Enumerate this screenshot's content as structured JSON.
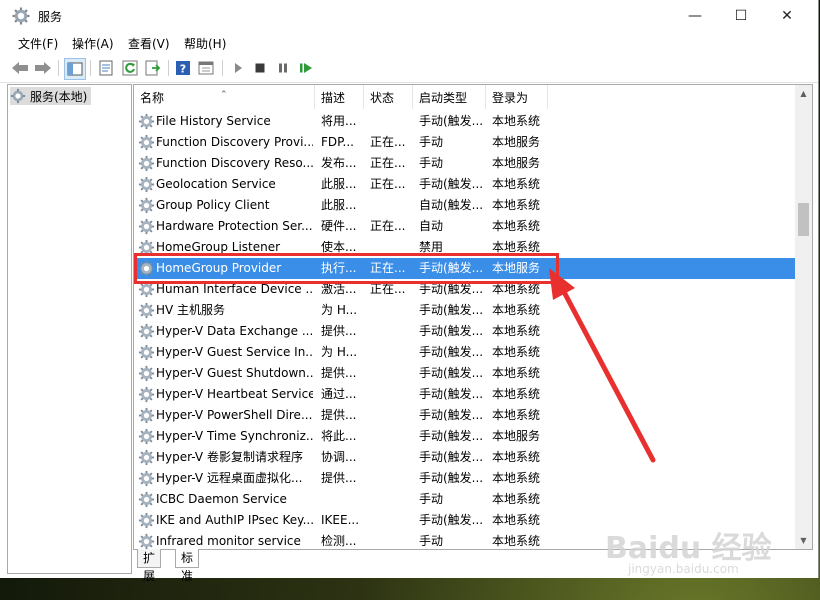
{
  "window": {
    "title": "服务",
    "controls": {
      "minimize": "—",
      "maximize": "☐",
      "close": "✕"
    }
  },
  "menu": [
    "文件(F)",
    "操作(A)",
    "查看(V)",
    "帮助(H)"
  ],
  "toolbar_icons": [
    "back-icon",
    "forward-icon",
    "console-tree-icon",
    "properties-icon",
    "refresh-icon",
    "export-icon",
    "help-icon",
    "view-icon",
    "start-icon",
    "stop-icon",
    "pause-icon",
    "restart-icon"
  ],
  "tree": {
    "label": "服务(本地)"
  },
  "columns": {
    "name": "名称",
    "desc": "描述",
    "status": "状态",
    "startup": "启动类型",
    "logon": "登录为"
  },
  "services": [
    {
      "name": "File History Service",
      "desc": "将用...",
      "status": "",
      "startup": "手动(触发...",
      "logon": "本地系统"
    },
    {
      "name": "Function Discovery Provi...",
      "desc": "FDP...",
      "status": "正在...",
      "startup": "手动",
      "logon": "本地服务"
    },
    {
      "name": "Function Discovery Reso...",
      "desc": "发布...",
      "status": "正在...",
      "startup": "手动",
      "logon": "本地服务"
    },
    {
      "name": "Geolocation Service",
      "desc": "此服...",
      "status": "正在...",
      "startup": "手动(触发...",
      "logon": "本地系统"
    },
    {
      "name": "Group Policy Client",
      "desc": "此服...",
      "status": "",
      "startup": "自动(触发...",
      "logon": "本地系统"
    },
    {
      "name": "Hardware Protection Ser...",
      "desc": "硬件...",
      "status": "正在...",
      "startup": "自动",
      "logon": "本地系统"
    },
    {
      "name": "HomeGroup Listener",
      "desc": "使本...",
      "status": "",
      "startup": "禁用",
      "logon": "本地系统"
    },
    {
      "name": "HomeGroup Provider",
      "desc": "执行...",
      "status": "正在...",
      "startup": "手动(触发...",
      "logon": "本地服务",
      "selected": true
    },
    {
      "name": "Human Interface Device ...",
      "desc": "激活...",
      "status": "正在...",
      "startup": "手动(触发...",
      "logon": "本地系统"
    },
    {
      "name": "HV 主机服务",
      "desc": "为 H...",
      "status": "",
      "startup": "手动(触发...",
      "logon": "本地系统"
    },
    {
      "name": "Hyper-V Data Exchange ...",
      "desc": "提供...",
      "status": "",
      "startup": "手动(触发...",
      "logon": "本地系统"
    },
    {
      "name": "Hyper-V Guest Service In...",
      "desc": "为 H...",
      "status": "",
      "startup": "手动(触发...",
      "logon": "本地系统"
    },
    {
      "name": "Hyper-V Guest Shutdown...",
      "desc": "提供...",
      "status": "",
      "startup": "手动(触发...",
      "logon": "本地系统"
    },
    {
      "name": "Hyper-V Heartbeat Service",
      "desc": "通过...",
      "status": "",
      "startup": "手动(触发...",
      "logon": "本地系统"
    },
    {
      "name": "Hyper-V PowerShell Dire...",
      "desc": "提供...",
      "status": "",
      "startup": "手动(触发...",
      "logon": "本地系统"
    },
    {
      "name": "Hyper-V Time Synchroniz...",
      "desc": "将此...",
      "status": "",
      "startup": "手动(触发...",
      "logon": "本地服务"
    },
    {
      "name": "Hyper-V 卷影复制请求程序",
      "desc": "协调...",
      "status": "",
      "startup": "手动(触发...",
      "logon": "本地系统"
    },
    {
      "name": "Hyper-V 远程桌面虚拟化...",
      "desc": "提供...",
      "status": "",
      "startup": "手动(触发...",
      "logon": "本地系统"
    },
    {
      "name": "ICBC Daemon Service",
      "desc": "",
      "status": "",
      "startup": "手动",
      "logon": "本地系统"
    },
    {
      "name": "IKE and AuthIP IPsec Key...",
      "desc": "IKEE...",
      "status": "",
      "startup": "手动(触发...",
      "logon": "本地系统"
    },
    {
      "name": "Infrared monitor service",
      "desc": "检测...",
      "status": "",
      "startup": "手动",
      "logon": "本地系统"
    }
  ],
  "tabs": [
    "扩展",
    "标准"
  ],
  "watermark": {
    "main": "Baidu 经验",
    "sub": "jingyan.baidu.com"
  },
  "colors": {
    "selection": "#3b8ee8",
    "annotation": "#e8302e"
  }
}
